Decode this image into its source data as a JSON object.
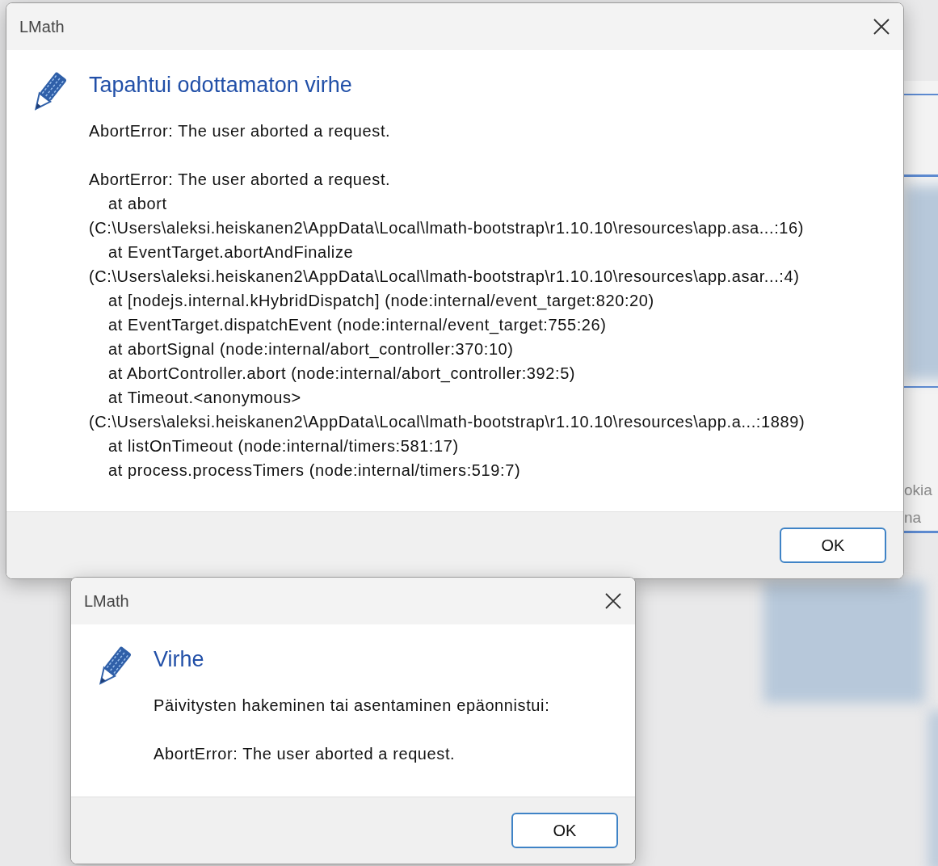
{
  "background": {
    "texts": [
      "okia",
      "na"
    ]
  },
  "dialogs": [
    {
      "title": "LMath",
      "heading": "Tapahtui odottamaton virhe",
      "paragraphs": [
        [
          {
            "text": "AbortError: The user aborted a request.",
            "indented": false
          }
        ],
        [
          {
            "text": "AbortError: The user aborted a request.",
            "indented": false
          },
          {
            "text": "at abort",
            "indented": true
          },
          {
            "text": "(C:\\Users\\aleksi.heiskanen2\\AppData\\Local\\lmath-bootstrap\\r1.10.10\\resources\\app.asa...:16)",
            "indented": false
          },
          {
            "text": "at EventTarget.abortAndFinalize",
            "indented": true
          },
          {
            "text": "(C:\\Users\\aleksi.heiskanen2\\AppData\\Local\\lmath-bootstrap\\r1.10.10\\resources\\app.asar...:4)",
            "indented": false
          },
          {
            "text": "at [nodejs.internal.kHybridDispatch] (node:internal/event_target:820:20)",
            "indented": true
          },
          {
            "text": "at EventTarget.dispatchEvent (node:internal/event_target:755:26)",
            "indented": true
          },
          {
            "text": "at abortSignal (node:internal/abort_controller:370:10)",
            "indented": true
          },
          {
            "text": "at AbortController.abort (node:internal/abort_controller:392:5)",
            "indented": true
          },
          {
            "text": "at Timeout.<anonymous>",
            "indented": true
          },
          {
            "text": "(C:\\Users\\aleksi.heiskanen2\\AppData\\Local\\lmath-bootstrap\\r1.10.10\\resources\\app.a...:1889)",
            "indented": false
          },
          {
            "text": "at listOnTimeout (node:internal/timers:581:17)",
            "indented": true
          },
          {
            "text": "at process.processTimers (node:internal/timers:519:7)",
            "indented": true
          }
        ]
      ],
      "button": "OK"
    },
    {
      "title": "LMath",
      "heading": "Virhe",
      "paragraphs": [
        [
          {
            "text": "Päivitysten hakeminen tai asentaminen epäonnistui:",
            "indented": false
          }
        ],
        [
          {
            "text": "AbortError: The user aborted a request.",
            "indented": false
          }
        ]
      ],
      "button": "OK"
    }
  ]
}
